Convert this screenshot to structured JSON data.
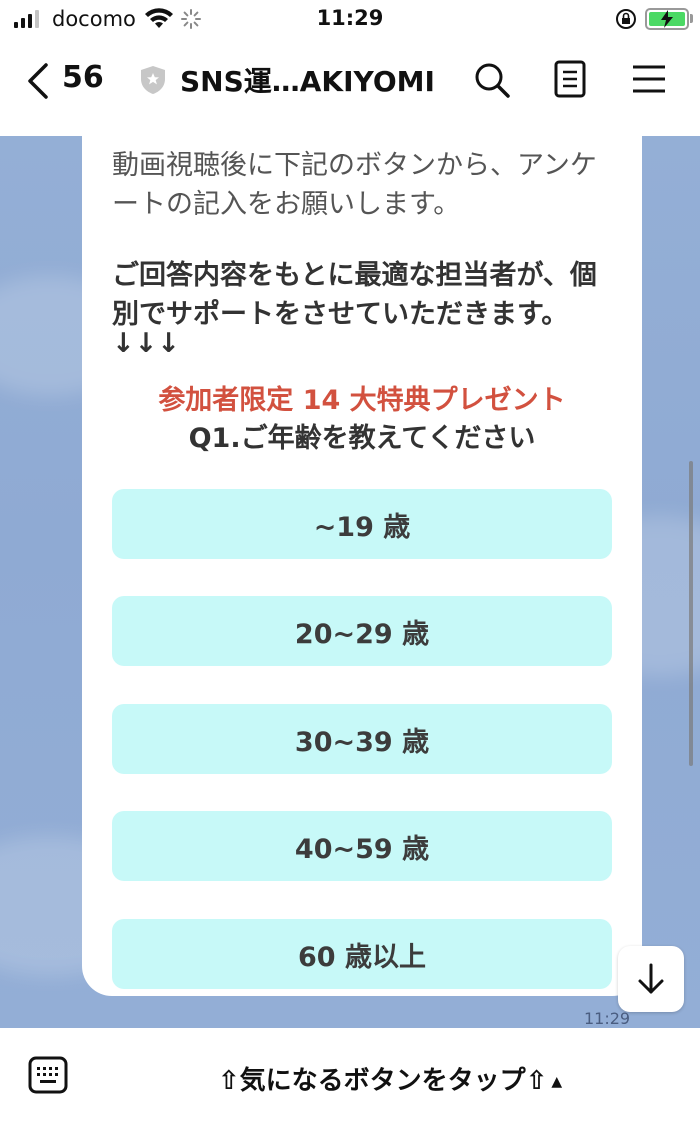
{
  "status_bar": {
    "carrier": "docomo",
    "time": "11:29",
    "battery_level": 1.0
  },
  "header": {
    "back_count": "56",
    "title": "SNS運…AKIYOMI"
  },
  "message": {
    "intro": "動画視聴後に下記のボタンから、アンケートの記入をお願いします。",
    "support": "ご回答内容をもとに最適な担当者が、個別でサポートをさせていただきます。",
    "arrows": "↓↓↓",
    "present": "参加者限定 14 大特典プレゼント",
    "question": "Q1.ご年齢を教えてください",
    "answers": [
      "~19 歳",
      "20~29 歳",
      "30~39 歳",
      "40~59 歳",
      "60 歳以上"
    ],
    "time": "11:29"
  },
  "bottom_bar": {
    "rich_menu_label": "⇧気になるボタンをタップ⇧"
  },
  "colors": {
    "chat_background": "#93aed6",
    "answer_button": "#c7f9f8",
    "present_text": "#d2513f",
    "battery": "#4bd964"
  },
  "icons": [
    "back-chevron-icon",
    "shield-icon",
    "search-icon",
    "notes-icon",
    "menu-icon",
    "keyboard-icon",
    "arrow-down-icon",
    "wifi-icon",
    "signal-icon",
    "lock-rotation-icon",
    "battery-icon"
  ]
}
